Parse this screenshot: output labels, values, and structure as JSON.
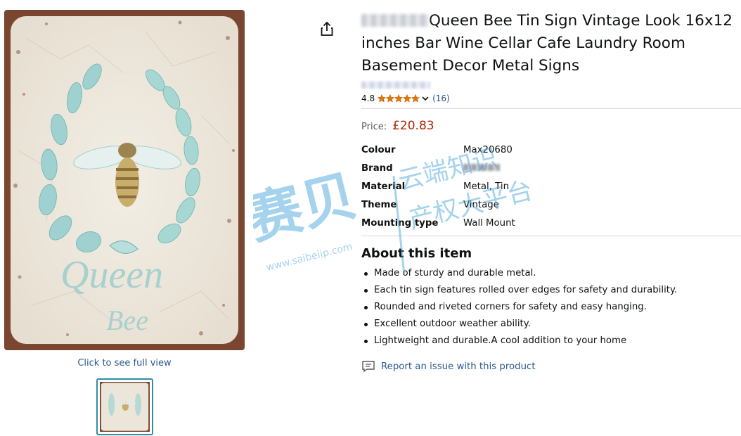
{
  "image": {
    "subject": "bee-wreath-tin-sign",
    "main_text_line1": "Queen",
    "main_text_line2": "Bee",
    "click_full_view": "Click to see full view",
    "thumbnail_count": 1,
    "colors": {
      "rust": "#7a4630",
      "panel": "#efe9dd",
      "leaf": "#8cc9c6",
      "bee": "#b79a57"
    }
  },
  "product": {
    "title_visible": "Queen Bee Tin Sign Vintage Look 16x12 inches Bar Wine Cellar Cafe Laundry Room Basement Decor Metal Signs",
    "rating": "4.8",
    "stars": 4.8,
    "rating_count": "(16)",
    "price_label": "Price:",
    "price": "£20.83"
  },
  "specs": [
    {
      "key": "Colour",
      "value": "Max20680"
    },
    {
      "key": "Brand",
      "value": ""
    },
    {
      "key": "Material",
      "value": "Metal, Tin"
    },
    {
      "key": "Theme",
      "value": "Vintage"
    },
    {
      "key": "Mounting type",
      "value": "Wall Mount"
    }
  ],
  "about": {
    "title": "About this item",
    "bullets": [
      "Made of sturdy and durable metal.",
      "Each tin sign features rolled over edges for safety and durability.",
      "Rounded and riveted corners for safety and easy hanging.",
      "Excellent outdoor weather ability.",
      "Lightweight and durable.A cool addition to your home"
    ]
  },
  "report": {
    "label": "Report an issue with this product"
  },
  "watermark": {
    "main": "赛贝",
    "line1": "云端知识",
    "line2": "产权大平台",
    "url": "www.saibeiip.com"
  },
  "theme": {
    "link": "#2a5a8c",
    "price": "#b12704",
    "star": "#e67a00",
    "watermark": "#3a9fd8",
    "thumb_border": "#2d8fa3"
  }
}
